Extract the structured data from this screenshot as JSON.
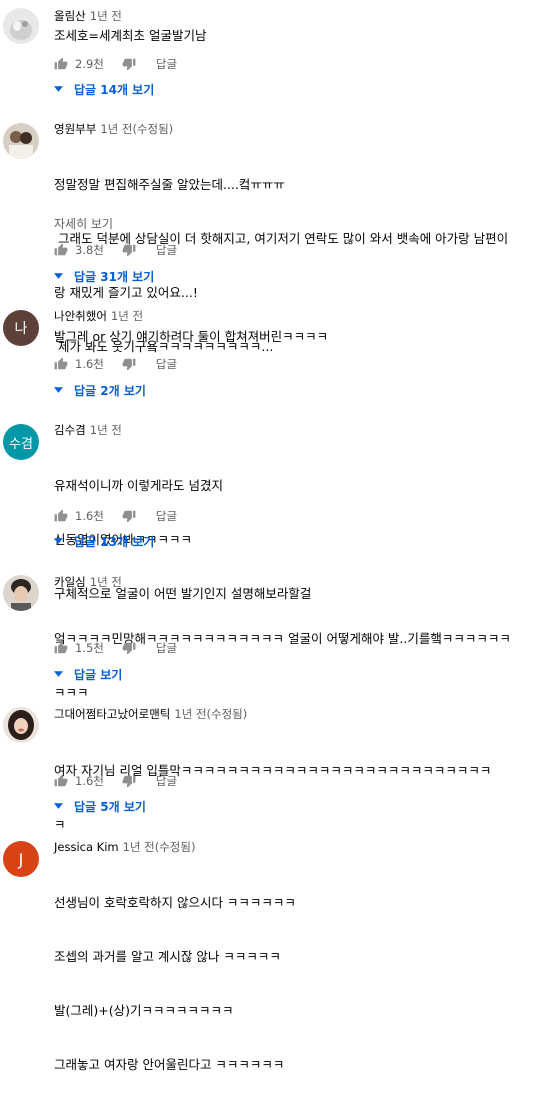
{
  "labels": {
    "reply": "답글",
    "show_more": "자세히 보기"
  },
  "comments": [
    {
      "author": "올림산",
      "time": "1년 전",
      "lines": [
        "조세호=세계최초 얼굴발기남"
      ],
      "likes": "2.9천",
      "replies": "답글 14개 보기",
      "avatar_icon": "cat-photo-avatar"
    },
    {
      "author": "영원부부",
      "time": "1년 전(수정됨)",
      "lines": [
        "정말정말 편집해주실줄 알았는데....컼ㅠㅠㅠ",
        " 그래도 덕분에 상담실이 더 핫해지고, 여기저기 연락도 많이 와서 뱃속에 아가랑 남편이",
        "랑 재밌게 즐기고 있어요...!",
        " 제가 봐도 웃기구욬ㅋㅋㅋㅋㅋㅋㅋㅋㅋ..."
      ],
      "show_more": true,
      "likes": "3.8천",
      "replies": "답글 31개 보기",
      "avatar_icon": "couple-photo-avatar"
    },
    {
      "author": "나안취했어",
      "time": "1년 전",
      "lines": [
        "발그레 or 상기 얘기하려다 둘이 합쳐져버린ㅋㅋㅋㅋ"
      ],
      "likes": "1.6천",
      "replies": "답글 2개 보기",
      "avatar_letter": "나",
      "avatar_color": "#5d4037"
    },
    {
      "author": "김수겸",
      "time": "1년 전",
      "lines": [
        "유재석이니까 이렇게라도 넘겼지",
        "신동엽이였어봐ㅋㅋㅋㅋㅋ",
        "구체적으로 얼굴이 어떤 발기인지 설명해보라할걸"
      ],
      "likes": "1.6천",
      "replies": "답글 13개 보기",
      "avatar_letter": "수겸",
      "avatar_color": "#0097a7"
    },
    {
      "author": "카일심",
      "time": "1년 전",
      "lines": [
        "엌ㅋㅋㅋㅋ민망해ㅋㅋㅋㅋㅋㅋㅋㅋㅋㅋㅋㅋ 얼굴이 어떻게해야 발..기를햌ㅋㅋㅋㅋㅋㅋ",
        "ㅋㅋㅋ"
      ],
      "likes": "1.5천",
      "replies": "답글 보기",
      "avatar_icon": "man-photo-avatar"
    },
    {
      "author": "그대어쩜타고났어로맨틱",
      "time": "1년 전(수정됨)",
      "lines": [
        "여자 자기님 리얼 입틀막ㅋㅋㅋㅋㅋㅋㅋㅋㅋㅋㅋㅋㅋㅋㅋㅋㅋㅋㅋㅋㅋㅋㅋㅋㅋㅋㅋ",
        "ㅋ"
      ],
      "likes": "1.6천",
      "replies": "답글 5개 보기",
      "avatar_icon": "woman-photo-avatar"
    },
    {
      "author": "Jessica Kim",
      "time": "1년 전(수정됨)",
      "lines": [
        "선생님이 호락호락하지 않으시다 ㅋㅋㅋㅋㅋㅋ",
        "조셉의 과거를 알고 계시잖 않나 ㅋㅋㅋㅋㅋ",
        "발(그레)+(상)기ㅋㅋㅋㅋㅋㅋㅋㅋ",
        "그래놓고 여자랑 안어울린다고 ㅋㅋㅋㅋㅋㅋ"
      ],
      "avatar_letter": "J",
      "avatar_color": "#d84315"
    }
  ]
}
